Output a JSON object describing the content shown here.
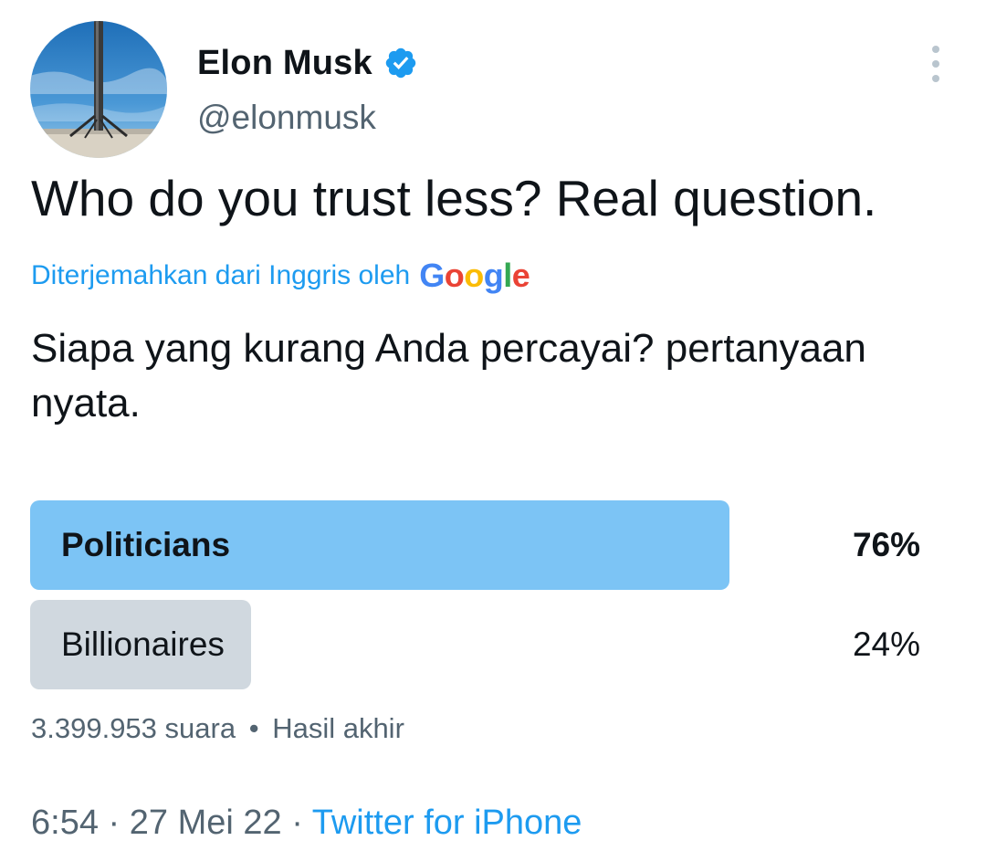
{
  "author": {
    "display_name": "Elon Musk",
    "handle": "@elonmusk",
    "verified": true
  },
  "icons": {
    "verified": "verified-badge-icon",
    "more": "more-vertical-icon"
  },
  "tweet": {
    "text": "Who do you trust less? Real question.",
    "translation_label": "Diterjemahkan dari Inggris oleh",
    "translation_provider": "Google",
    "translated_text": "Siapa yang kurang Anda percayai? pertanyaan nyata."
  },
  "poll": {
    "options": [
      {
        "label": "Politicians",
        "percent_text": "76%",
        "percent": 76,
        "winner": true
      },
      {
        "label": "Billionaires",
        "percent_text": "24%",
        "percent": 24,
        "winner": false
      }
    ],
    "votes": "3.399.953 suara",
    "separator": "•",
    "status": "Hasil akhir"
  },
  "meta": {
    "time": "6:54",
    "sep1": "·",
    "date": "27 Mei 22",
    "sep2": "·",
    "source": "Twitter for iPhone"
  },
  "colors": {
    "accent": "#1d9bf0",
    "winner_bar": "#7cc4f5",
    "other_bar": "#d0d8df",
    "secondary_text": "#536471"
  }
}
